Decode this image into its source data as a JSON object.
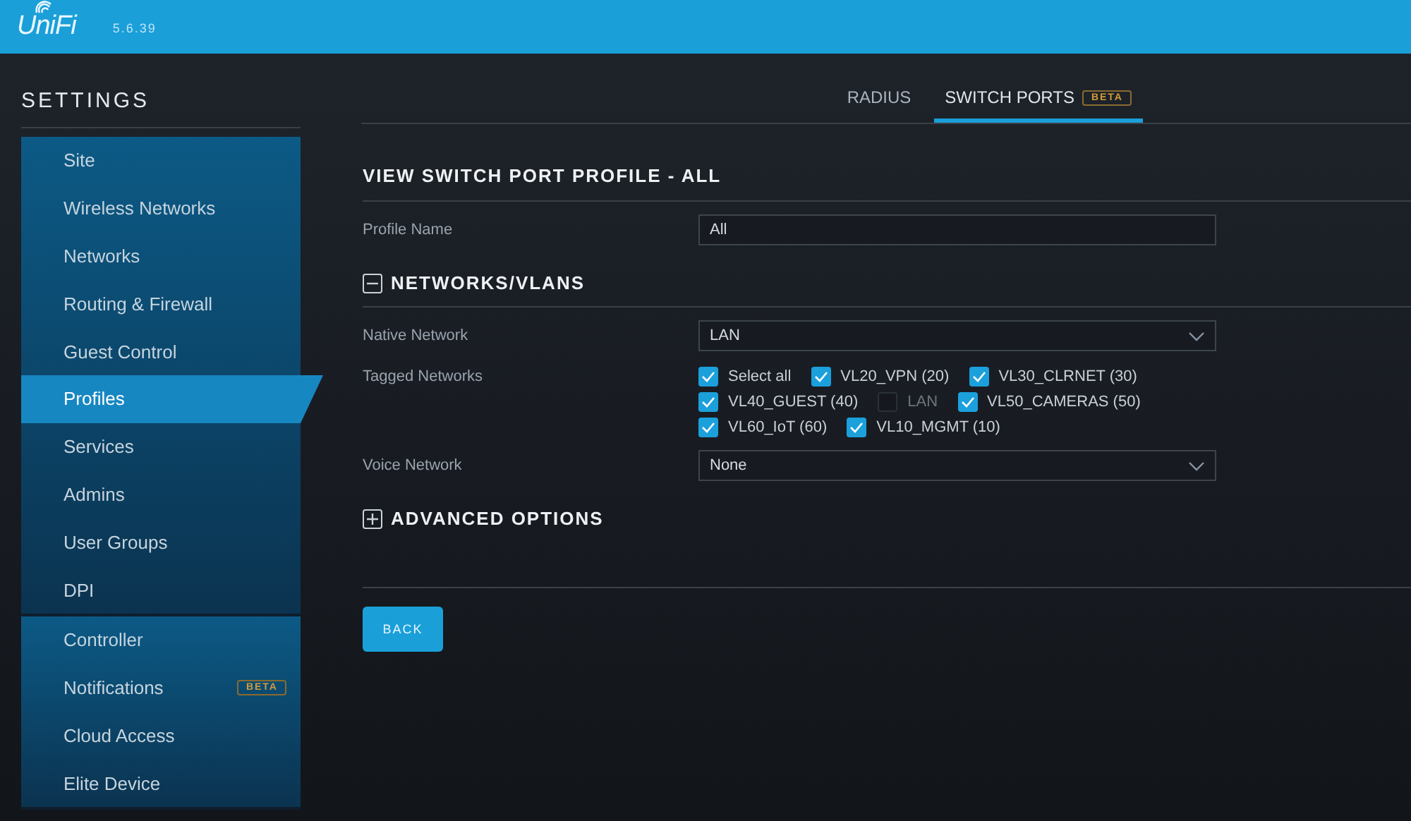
{
  "header": {
    "logo": "UniFi",
    "version": "5.6.39"
  },
  "sidebar": {
    "title": "SETTINGS",
    "groups": [
      {
        "items": [
          {
            "label": "Site",
            "selected": false
          },
          {
            "label": "Wireless Networks",
            "selected": false
          },
          {
            "label": "Networks",
            "selected": false
          },
          {
            "label": "Routing & Firewall",
            "selected": false
          },
          {
            "label": "Guest Control",
            "selected": false
          },
          {
            "label": "Profiles",
            "selected": true
          },
          {
            "label": "Services",
            "selected": false
          },
          {
            "label": "Admins",
            "selected": false
          },
          {
            "label": "User Groups",
            "selected": false
          },
          {
            "label": "DPI",
            "selected": false
          }
        ]
      },
      {
        "items": [
          {
            "label": "Controller",
            "selected": false
          },
          {
            "label": "Notifications",
            "selected": false,
            "badge": "BETA"
          },
          {
            "label": "Cloud Access",
            "selected": false
          },
          {
            "label": "Elite Device",
            "selected": false
          }
        ]
      }
    ]
  },
  "tabs": [
    {
      "label": "RADIUS",
      "selected": false
    },
    {
      "label": "SWITCH PORTS",
      "selected": true,
      "badge": "BETA"
    }
  ],
  "title": "VIEW SWITCH PORT PROFILE - ALL",
  "profile_name": {
    "label": "Profile Name",
    "value": "All"
  },
  "sections": [
    {
      "title": "NETWORKS/VLANS",
      "expanded": true,
      "native_network": {
        "label": "Native Network",
        "value": "LAN"
      },
      "tagged_networks": {
        "label": "Tagged Networks",
        "rows": [
          [
            {
              "label": "Select all",
              "checked": true
            },
            {
              "label": "VL20_VPN (20)",
              "checked": true
            },
            {
              "label": "VL30_CLRNET (30)",
              "checked": true
            }
          ],
          [
            {
              "label": "VL40_GUEST (40)",
              "checked": true
            },
            {
              "label": "LAN",
              "checked": false
            },
            {
              "label": "VL50_CAMERAS (50)",
              "checked": true
            }
          ],
          [
            {
              "label": "VL60_IoT (60)",
              "checked": true
            },
            {
              "label": "VL10_MGMT (10)",
              "checked": true
            }
          ]
        ]
      },
      "voice_network": {
        "label": "Voice Network",
        "value": "None"
      }
    },
    {
      "title": "ADVANCED OPTIONS",
      "expanded": false
    }
  ],
  "back_button": "BACK"
}
